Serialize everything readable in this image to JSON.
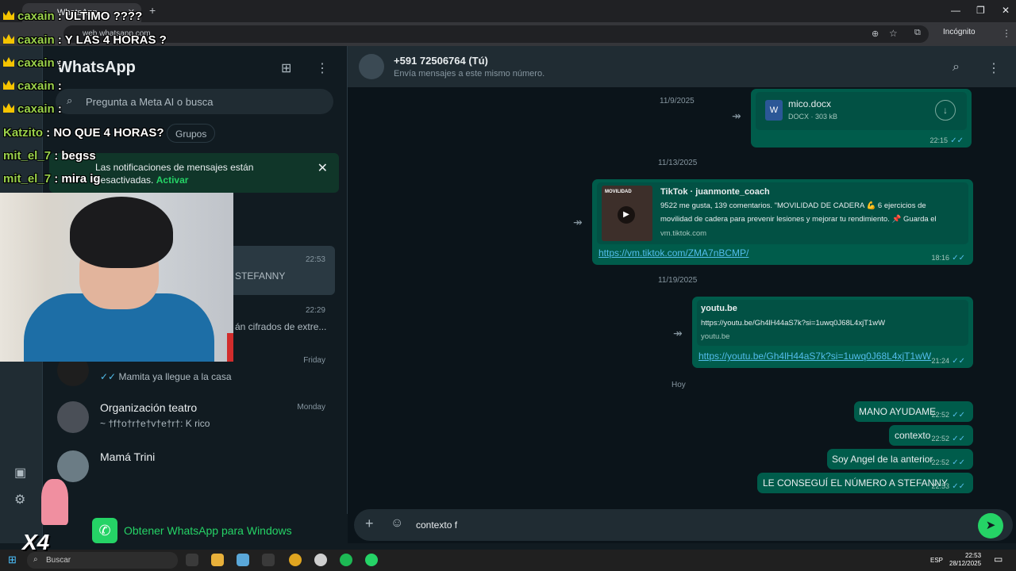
{
  "browser": {
    "tab_title": "WhatsApp",
    "url": "web.whatsapp.com",
    "incognito_label": "Incógnito"
  },
  "sidebar": {
    "app_title": "WhatsApp",
    "search_placeholder": "Pregunta a Meta AI o busca",
    "filter_chip": "Grupos",
    "notification_text": "Las notificaciones de mensajes están desactivadas.",
    "notification_action": "Activar",
    "chats": [
      {
        "name": "",
        "time": "22:53",
        "preview": "STEFANNY"
      },
      {
        "name": "",
        "time": "22:29",
        "preview": "án cifrados de extre..."
      },
      {
        "name": "",
        "time": "Friday",
        "preview": "Mamita ya llegue a la casa"
      },
      {
        "name": "Organización teatro",
        "time": "Monday",
        "preview": "~ †f†o†r†e†v†e†r†: K rico"
      },
      {
        "name": "Mamá Trini",
        "time": "",
        "preview": ""
      }
    ],
    "get_app_label": "Obtener WhatsApp para Windows"
  },
  "chat": {
    "contact_name": "+591 72506764 (Tú)",
    "contact_subtitle": "Envía mensajes a este mismo número.",
    "messages": {
      "date1": "11/9/2025",
      "file_name": "mico.docx",
      "file_meta": "DOCX · 303 kB",
      "file_time": "22:15",
      "date2": "11/13/2025",
      "tiktok_title": "TikTok · juanmonte_coach",
      "tiktok_desc1": "9522 me gusta, 139 comentarios. \"MOVILIDAD DE CADERA 💪 6 ejercicios de",
      "tiktok_desc2": "movilidad de cadera para prevenir lesiones y mejorar tu rendimiento. 📌 Guarda el",
      "tiktok_domain": "vm.tiktok.com",
      "tiktok_link": "https://vm.tiktok.com/ZMA7nBCMP/",
      "tiktok_time": "18:16",
      "tiktok_thumb": "MOVILIDAD",
      "date3": "11/19/2025",
      "yt_title": "youtu.be",
      "yt_url": "https://youtu.be/Gh4lH44aS7k?si=1uwq0J68L4xjT1wW",
      "yt_domain": "youtu.be",
      "yt_link": "https://youtu.be/Gh4lH44aS7k?si=1uwq0J68L4xjT1wW",
      "yt_time": "21:24",
      "date4": "Hoy",
      "m1": "MANO AYUDAME",
      "m1_time": "22:52",
      "m2": "contexto",
      "m2_time": "22:52",
      "m3": "Soy Angel de la anterior",
      "m3_time": "22:52",
      "m4": "LE CONSEGUÍ EL NÚMERO A STEFANNY",
      "m4_time": "22:53"
    },
    "composer_text": "contexto f"
  },
  "taskbar": {
    "search_label": "Buscar",
    "lang": "ESP",
    "time": "22:53",
    "date": "28/12/2025"
  },
  "overlay": {
    "chat_lines": [
      {
        "user": "caxain",
        "text": ": ULTIMO ????"
      },
      {
        "user": "caxain",
        "text": ": Y LAS 4 HORAS ?"
      },
      {
        "user": "caxain",
        "text": ":"
      },
      {
        "user": "caxain",
        "text": ":"
      },
      {
        "user": "caxain",
        "text": ":"
      },
      {
        "user": "Katzito",
        "text": ": NO QUE 4 HORAS?"
      },
      {
        "user": "mit_el_7",
        "text": ": begss"
      },
      {
        "user": "mit_el_7",
        "text": ": mira ig"
      }
    ],
    "multiplier": "X4"
  },
  "colors": {
    "accent": "#25d366",
    "bubble": "#005c4b",
    "background": "#0b141a",
    "read_check": "#53bdeb"
  }
}
